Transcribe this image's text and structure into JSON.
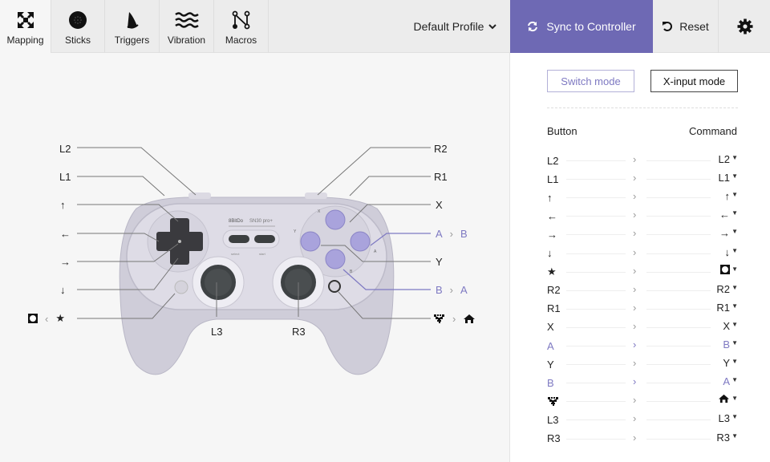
{
  "tabs": [
    {
      "label": "Mapping",
      "icon": "mapping-icon",
      "active": true
    },
    {
      "label": "Sticks",
      "icon": "sticks-icon",
      "active": false
    },
    {
      "label": "Triggers",
      "icon": "triggers-icon",
      "active": false
    },
    {
      "label": "Vibration",
      "icon": "vibration-icon",
      "active": false
    },
    {
      "label": "Macros",
      "icon": "macros-icon",
      "active": false
    }
  ],
  "toolbar": {
    "profile": "Default Profile",
    "sync_label": "Sync to Controller",
    "reset_label": "Reset"
  },
  "colors": {
    "accent": "#6e69b4",
    "changed": "#7e79c2"
  },
  "panel": {
    "mode_switch": "Switch mode",
    "mode_xinput": "X-input mode",
    "header_button": "Button",
    "header_command": "Command",
    "rows": [
      {
        "button": "L2",
        "command": "L2",
        "changed": false
      },
      {
        "button": "L1",
        "command": "L1",
        "changed": false
      },
      {
        "button": "↑",
        "command": "↑",
        "changed": false
      },
      {
        "button": "←",
        "command": "←",
        "changed": false
      },
      {
        "button": "→",
        "command": "→",
        "changed": false
      },
      {
        "button": "↓",
        "command": "↓",
        "changed": false
      },
      {
        "button": "★",
        "command": "screenshot-icon",
        "changed": false
      },
      {
        "button": "R2",
        "command": "R2",
        "changed": false
      },
      {
        "button": "R1",
        "command": "R1",
        "changed": false
      },
      {
        "button": "X",
        "command": "X",
        "changed": false
      },
      {
        "button": "A",
        "command": "B",
        "changed": true
      },
      {
        "button": "Y",
        "command": "Y",
        "changed": false
      },
      {
        "button": "B",
        "command": "A",
        "changed": true
      },
      {
        "button": "heart-icon",
        "command": "home-icon",
        "changed": false
      },
      {
        "button": "L3",
        "command": "L3",
        "changed": false
      },
      {
        "button": "R3",
        "command": "R3",
        "changed": false
      }
    ]
  },
  "diagram": {
    "left": {
      "l2": "L2",
      "l1": "L1",
      "up": "↑",
      "left": "←",
      "right": "→",
      "down": "↓",
      "star": "★",
      "star_sep": "‹"
    },
    "right": {
      "r2": "R2",
      "r1": "R1",
      "x": "X",
      "a": "A",
      "a_to": "B",
      "y": "Y",
      "b": "B",
      "b_to": "A",
      "sep": "›"
    },
    "l3": "L3",
    "r3": "R3",
    "brand": "8BitDo",
    "model": "SN30 pro+",
    "select": "select",
    "start": "start"
  }
}
